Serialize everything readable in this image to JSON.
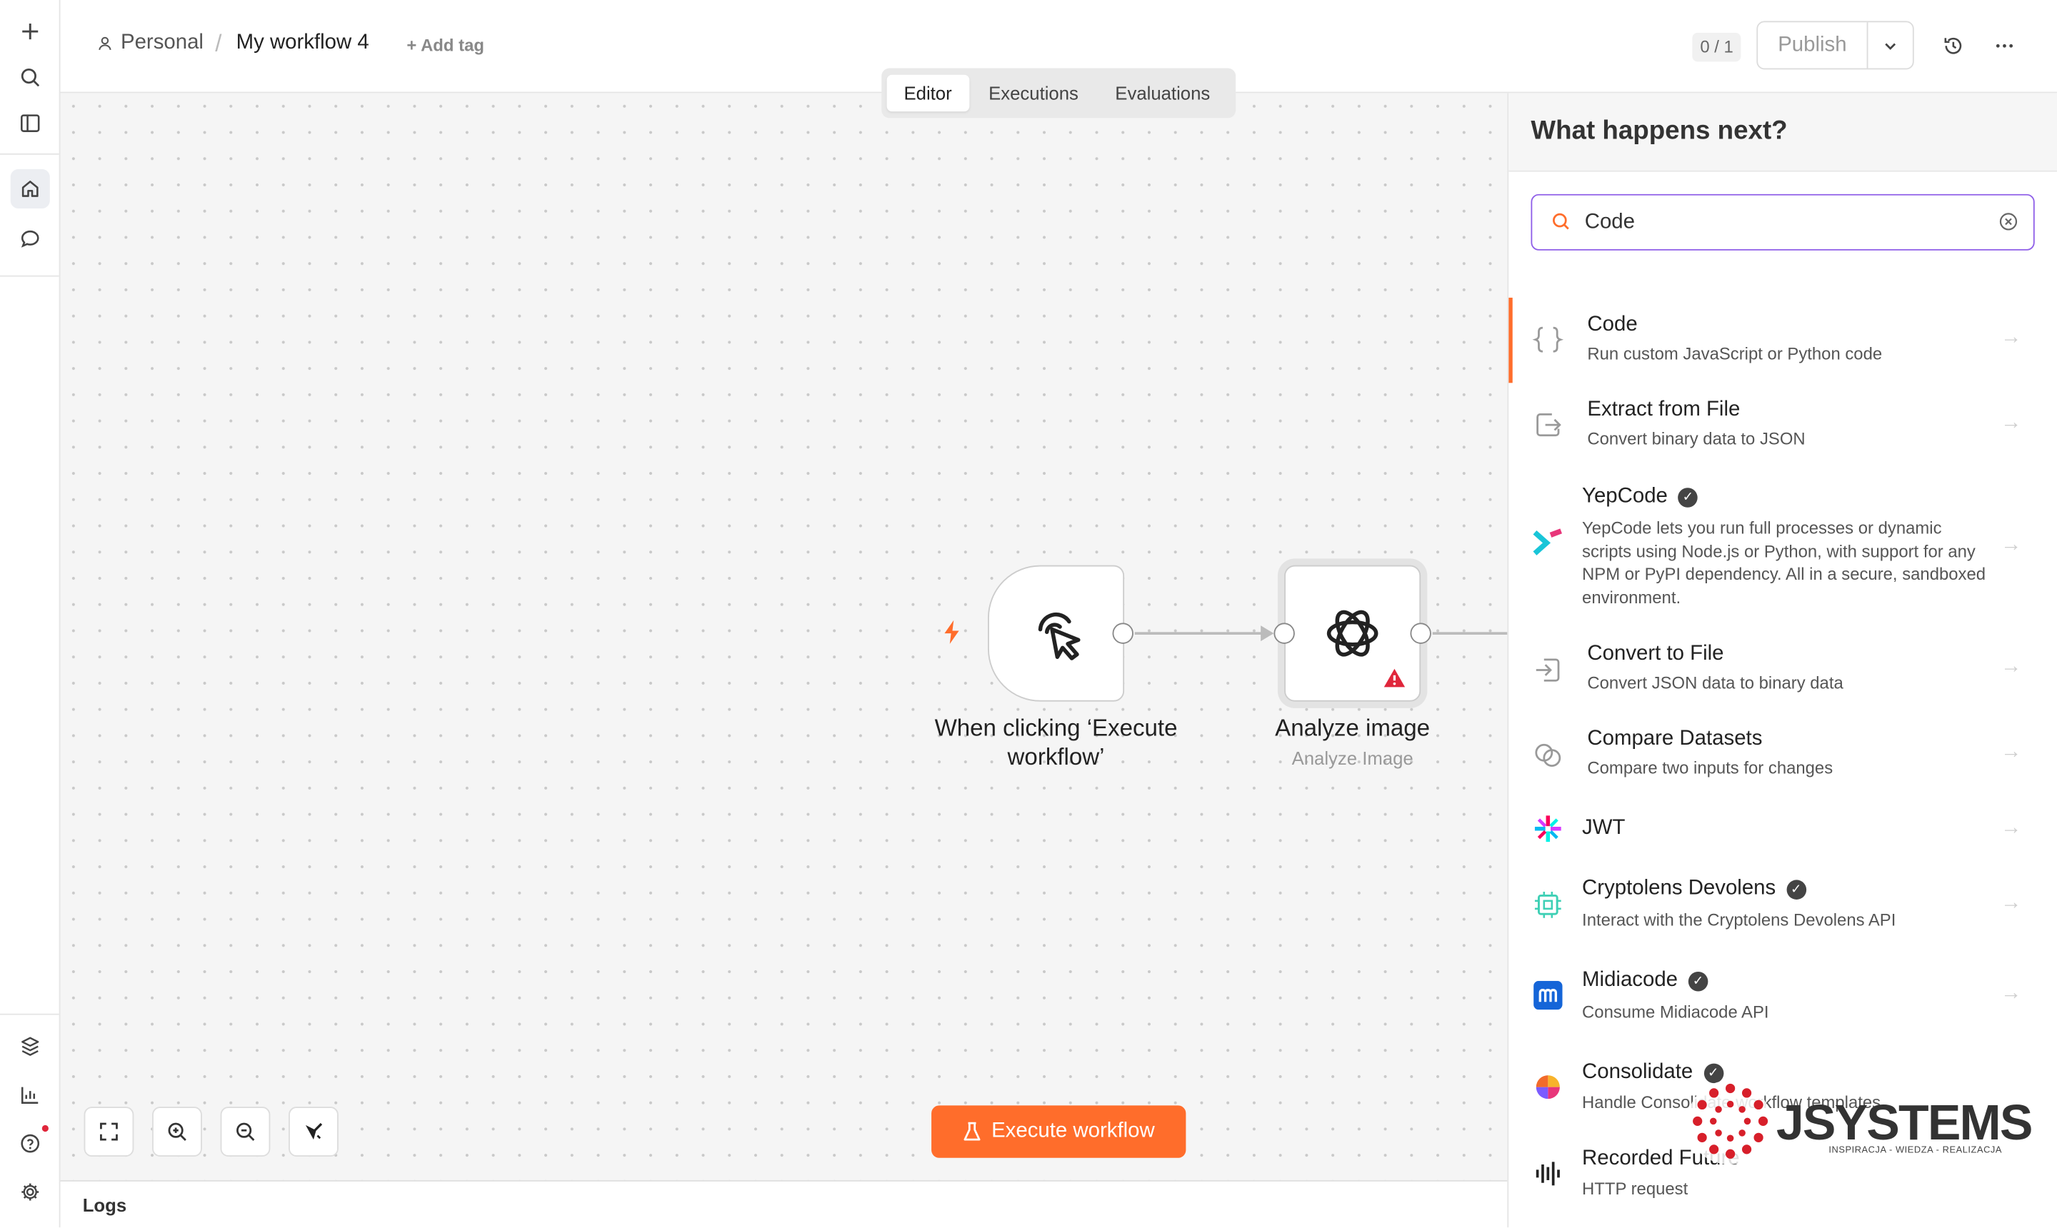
{
  "header": {
    "project": "Personal",
    "separator": "/",
    "workflow_name": "My workflow 4",
    "add_tag": "+ Add tag",
    "counter": "0 / 1",
    "publish": "Publish"
  },
  "tabs": [
    {
      "label": "Editor",
      "active": true
    },
    {
      "label": "Executions",
      "active": false
    },
    {
      "label": "Evaluations",
      "active": false
    }
  ],
  "nodes": {
    "trigger": {
      "label": "When clicking ‘Execute workflow’"
    },
    "ai": {
      "label": "Analyze image",
      "subtitle": "Analyze Image"
    }
  },
  "execute_button": "Execute workflow",
  "logs": "Logs",
  "panel": {
    "title": "What happens next?",
    "search_value": "Code",
    "items": [
      {
        "title": "Code",
        "desc": "Run custom JavaScript or Python code",
        "icon": "code-braces-icon",
        "verified": false
      },
      {
        "title": "Extract from File",
        "desc": "Convert binary data to JSON",
        "icon": "file-export-icon",
        "verified": false
      },
      {
        "title": "YepCode",
        "desc": "YepCode lets you run full processes or dynamic scripts using Node.js or Python, with support for any NPM or PyPI dependency. All in a secure, sandboxed environment.",
        "icon": "yepcode-logo-icon",
        "verified": true
      },
      {
        "title": "Convert to File",
        "desc": "Convert JSON data to binary data",
        "icon": "file-import-icon",
        "verified": false
      },
      {
        "title": "Compare Datasets",
        "desc": "Compare two inputs for changes",
        "icon": "compare-circles-icon",
        "verified": false
      },
      {
        "title": "JWT",
        "desc": "",
        "icon": "jwt-logo-icon",
        "verified": false
      },
      {
        "title": "Cryptolens Devolens",
        "desc": "Interact with the Cryptolens Devolens API",
        "icon": "chip-icon",
        "verified": true
      },
      {
        "title": "Midiacode",
        "desc": "Consume Midiacode API",
        "icon": "midiacode-logo-icon",
        "verified": true
      },
      {
        "title": "Consolidate",
        "desc": "Handle Consolidate workflow templates",
        "icon": "consolidate-logo-icon",
        "verified": true
      },
      {
        "title": "Recorded Future",
        "desc": "HTTP request",
        "icon": "recorded-future-icon",
        "verified": false
      }
    ]
  },
  "watermark": {
    "brand": "JSYSTEMS",
    "tagline": "INSPIRACJA - WIEDZA - REALIZACJA"
  },
  "colors": {
    "accent": "#ff6d2b",
    "search_border": "#8f5fe8",
    "warning": "#e0263b"
  }
}
